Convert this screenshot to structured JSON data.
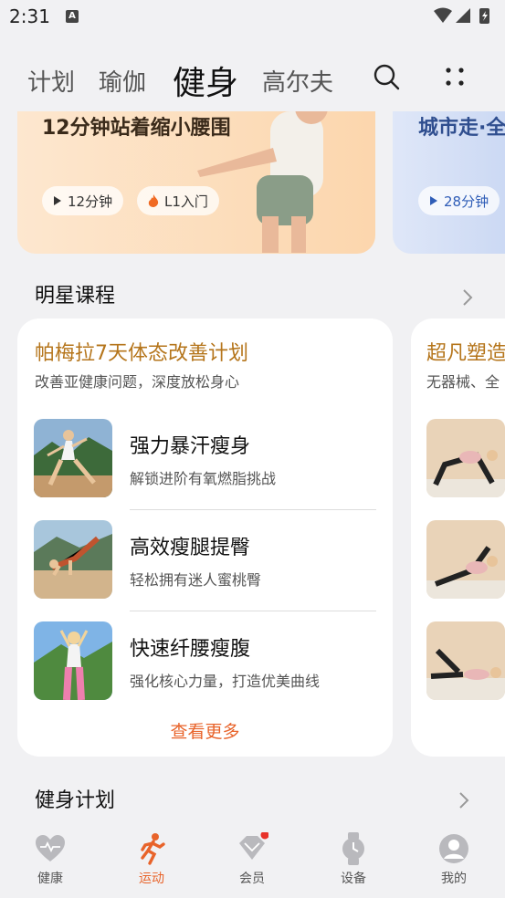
{
  "status": {
    "time": "2:31"
  },
  "tabs": [
    "计划",
    "瑜伽",
    "健身",
    "高尔夫"
  ],
  "banners": [
    {
      "title": "12分钟站着缩小腰围",
      "duration": "12分钟",
      "level": "L1入门"
    },
    {
      "title": "城市走·全",
      "duration": "28分钟"
    }
  ],
  "star": {
    "title": "明星课程",
    "cards": [
      {
        "title": "帕梅拉7天体态改善计划",
        "subtitle": "改善亚健康问题，深度放松身心",
        "items": [
          {
            "title": "强力暴汗瘦身",
            "subtitle": "解锁进阶有氧燃脂挑战"
          },
          {
            "title": "高效瘦腿提臀",
            "subtitle": "轻松拥有迷人蜜桃臀"
          },
          {
            "title": "快速纤腰瘦腹",
            "subtitle": "强化核心力量，打造优美曲线"
          }
        ],
        "more": "查看更多"
      },
      {
        "title": "超凡塑造",
        "subtitle": "无器械、全"
      }
    ]
  },
  "plan": {
    "title": "健身计划"
  },
  "nav": [
    {
      "label": "健康",
      "icon": "heart-icon"
    },
    {
      "label": "运动",
      "icon": "running-icon"
    },
    {
      "label": "会员",
      "icon": "diamond-icon"
    },
    {
      "label": "设备",
      "icon": "watch-icon"
    },
    {
      "label": "我的",
      "icon": "user-icon"
    }
  ],
  "colors": {
    "accent": "#e8632a",
    "gold": "#b5751b"
  }
}
